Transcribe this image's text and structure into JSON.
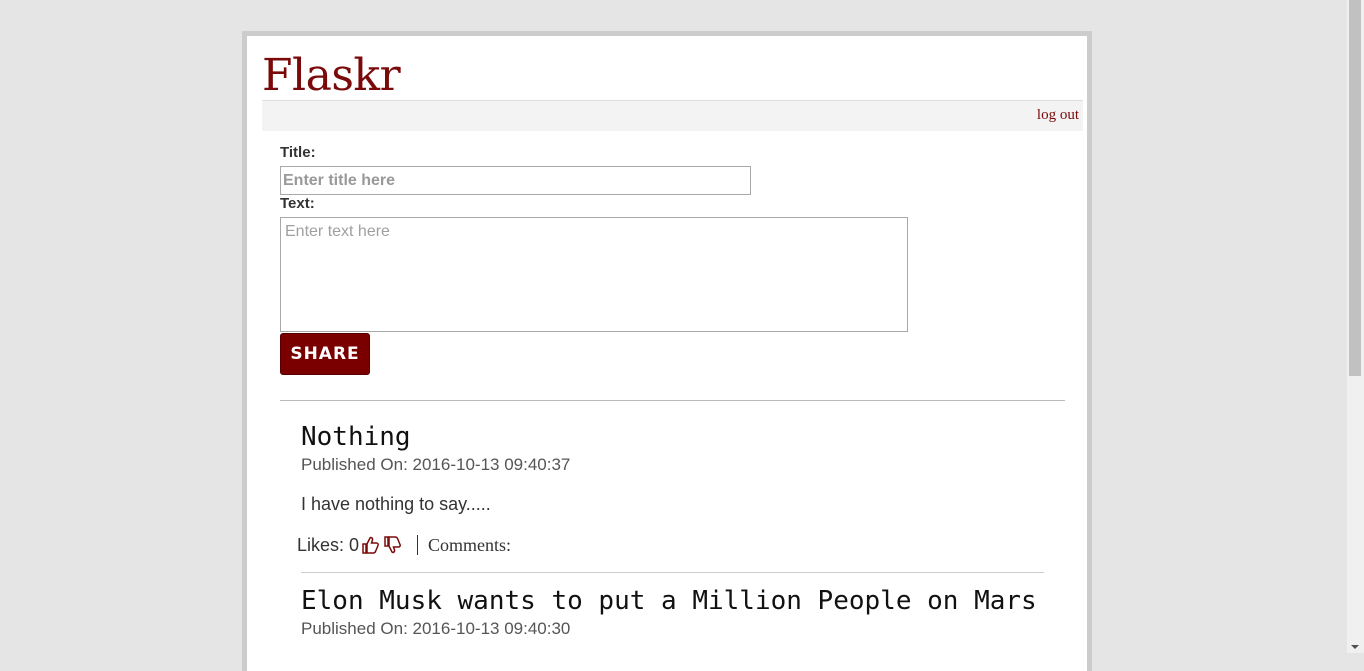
{
  "app": {
    "brand": "Flaskr"
  },
  "nav": {
    "logout_label": "log out"
  },
  "form": {
    "title_label": "Title:",
    "title_placeholder": "Enter title here",
    "text_label": "Text:",
    "text_placeholder": "Enter text here",
    "share_label": "SHARE"
  },
  "entries": [
    {
      "title": "Nothing",
      "published": "Published On: 2016-10-13 09:40:37",
      "text": "I have nothing to say.....",
      "likes_label": "Likes: 0",
      "comments_label": "Comments:"
    },
    {
      "title": "Elon Musk wants to put a Million People on Mars",
      "published": "Published On: 2016-10-13 09:40:30"
    }
  ],
  "colors": {
    "accent": "#7a0a0a",
    "button": "#7a0000",
    "background": "#e5e5e5"
  },
  "icons": [
    "thumbs-up-icon",
    "thumbs-down-icon"
  ]
}
